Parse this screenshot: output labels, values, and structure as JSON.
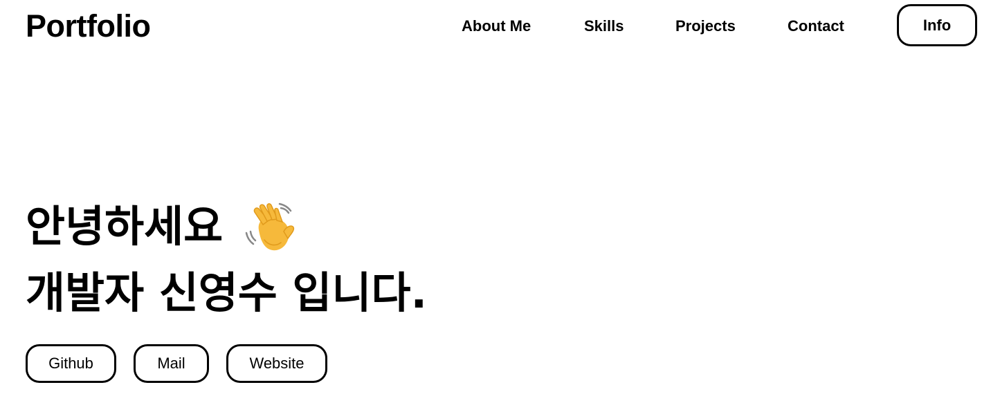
{
  "header": {
    "logo": "Portfolio",
    "nav": {
      "about": "About Me",
      "skills": "Skills",
      "projects": "Projects",
      "contact": "Contact"
    },
    "info_button": "Info"
  },
  "hero": {
    "line1": "안녕하세요",
    "line1_icon": "waving-hand-emoji",
    "line2": "개발자 신영수 입니다."
  },
  "links": {
    "github": "Github",
    "mail": "Mail",
    "website": "Website"
  },
  "colors": {
    "text": "#000000",
    "background": "#ffffff",
    "hand": "#F6B93B"
  }
}
